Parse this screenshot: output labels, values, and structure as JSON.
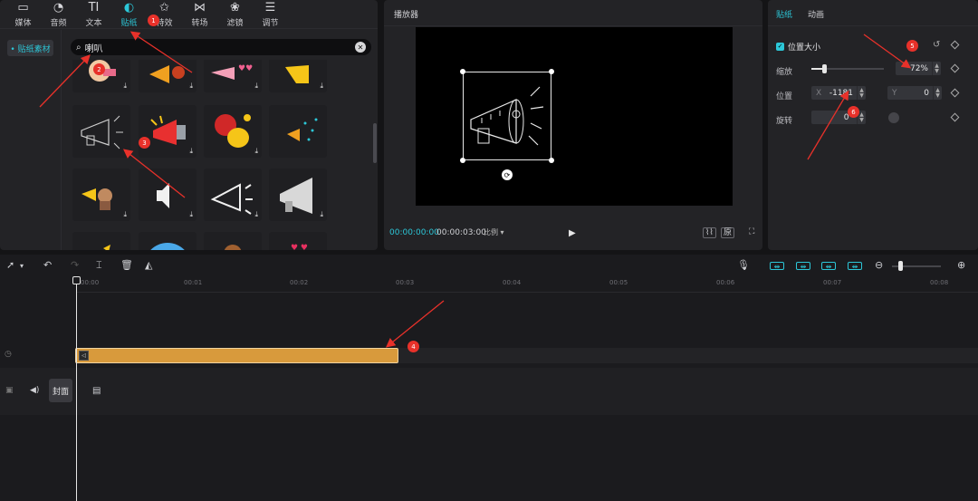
{
  "tool_tabs": [
    {
      "label": "媒体",
      "icon": "media-icon"
    },
    {
      "label": "音频",
      "icon": "audio-icon"
    },
    {
      "label": "文本",
      "icon": "text-icon"
    },
    {
      "label": "贴纸",
      "icon": "sticker-icon",
      "active": true
    },
    {
      "label": "特效",
      "icon": "effects-icon"
    },
    {
      "label": "转场",
      "icon": "transition-icon"
    },
    {
      "label": "滤镜",
      "icon": "filter-icon"
    },
    {
      "label": "调节",
      "icon": "adjust-icon"
    }
  ],
  "sidebar": {
    "sticker_library_label": "• 贴纸素材"
  },
  "search": {
    "value": "喇叭"
  },
  "player": {
    "title": "播放器",
    "current_time": "00:00:00:00",
    "total_time": "00:00:03:00",
    "ratio_label": "比例 ▾"
  },
  "props": {
    "tab_sticker": "贴纸",
    "tab_animation": "动画",
    "section_title": "位置大小",
    "scale_label": "缩放",
    "scale_value": "72%",
    "scale_fraction": 0.72,
    "position_label": "位置",
    "pos_x_prefix": "X",
    "pos_x_value": "-1181",
    "pos_y_prefix": "Y",
    "pos_y_value": "0",
    "rotation_label": "旋转",
    "rotation_value": "0°"
  },
  "timeline": {
    "ruler_ticks": [
      "00:00",
      "00:01",
      "00:02",
      "00:03",
      "00:04",
      "00:05",
      "00:06",
      "00:07",
      "00:08"
    ],
    "cover_label": "封面"
  },
  "annotations": [
    "1",
    "2",
    "3",
    "4",
    "5",
    "6"
  ],
  "colors": {
    "accent": "#2cc7d8",
    "clip": "#d89a3c",
    "annotation": "#e8312a"
  }
}
